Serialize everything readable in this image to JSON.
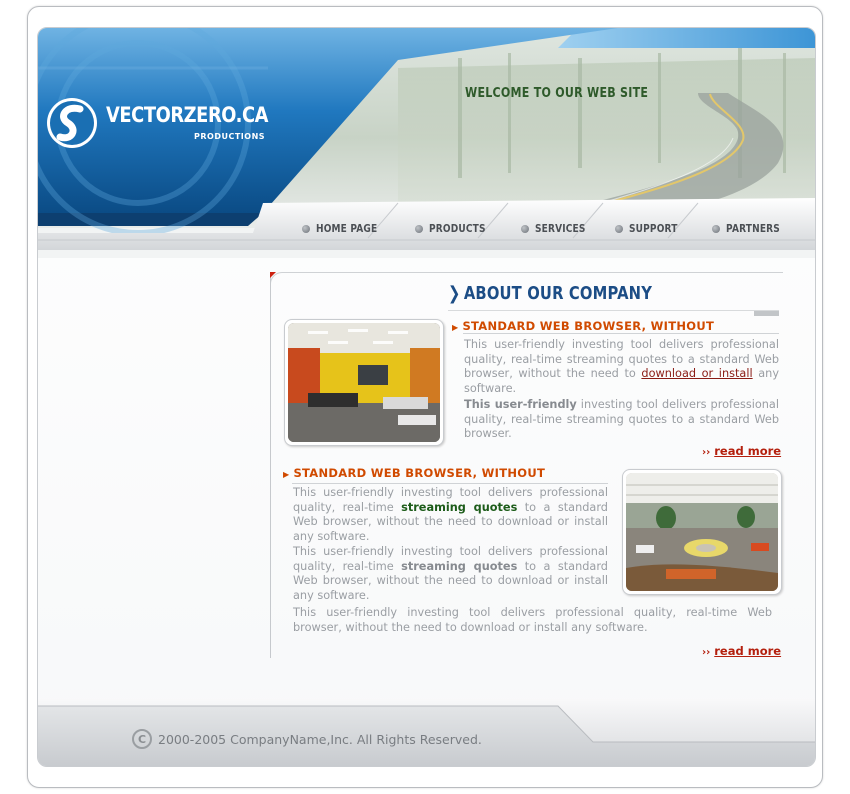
{
  "site": {
    "logo_title": "VECTORZERO.CA",
    "logo_subtitle": "PRODUCTIONS",
    "welcome": "WELCOME TO OUR WEB SITE"
  },
  "nav": [
    {
      "label": "HOME PAGE"
    },
    {
      "label": "PRODUCTS"
    },
    {
      "label": "SERVICES"
    },
    {
      "label": "SUPPORT"
    },
    {
      "label": "PARTNERS"
    }
  ],
  "main": {
    "title": "ABOUT OUR COMPANY",
    "block1": {
      "heading": "STANDARD WEB BROWSER, WITHOUT",
      "p1_a": "This user-friendly investing tool delivers professional quality, real-time streaming quotes to a standard Web browser, without the need to ",
      "p1_link": "download or install",
      "p1_b": " any software.",
      "p2_bold": "This user-friendly",
      "p2_rest": " investing tool delivers professional quality, real-time streaming quotes to a standard Web browser.",
      "read_more": "read more"
    },
    "block2": {
      "heading": "STANDARD WEB BROWSER, WITHOUT",
      "p1_a": "This user-friendly investing tool delivers professional quality, real-time ",
      "p1_green": "streaming quotes",
      "p1_b": " to a standard Web browser, without the need to download or install any software.",
      "p2_a": "This user-friendly investing tool delivers professional quality, real-time ",
      "p2_bold": "streaming quotes",
      "p2_b": " to a standard Web browser, without the need to download or install any software.",
      "p3": "This user-friendly investing tool delivers professional quality, real-time Web browser, without the need to download or install any software.",
      "read_more": "read more"
    }
  },
  "footer": {
    "copyright": "2000-2005 CompanyName,Inc. All Rights Reserved."
  },
  "colors": {
    "brand_blue": "#0f5d9c",
    "heading_orange": "#d04a00",
    "title_blue": "#1c4d86",
    "link_red": "#b4200e"
  }
}
